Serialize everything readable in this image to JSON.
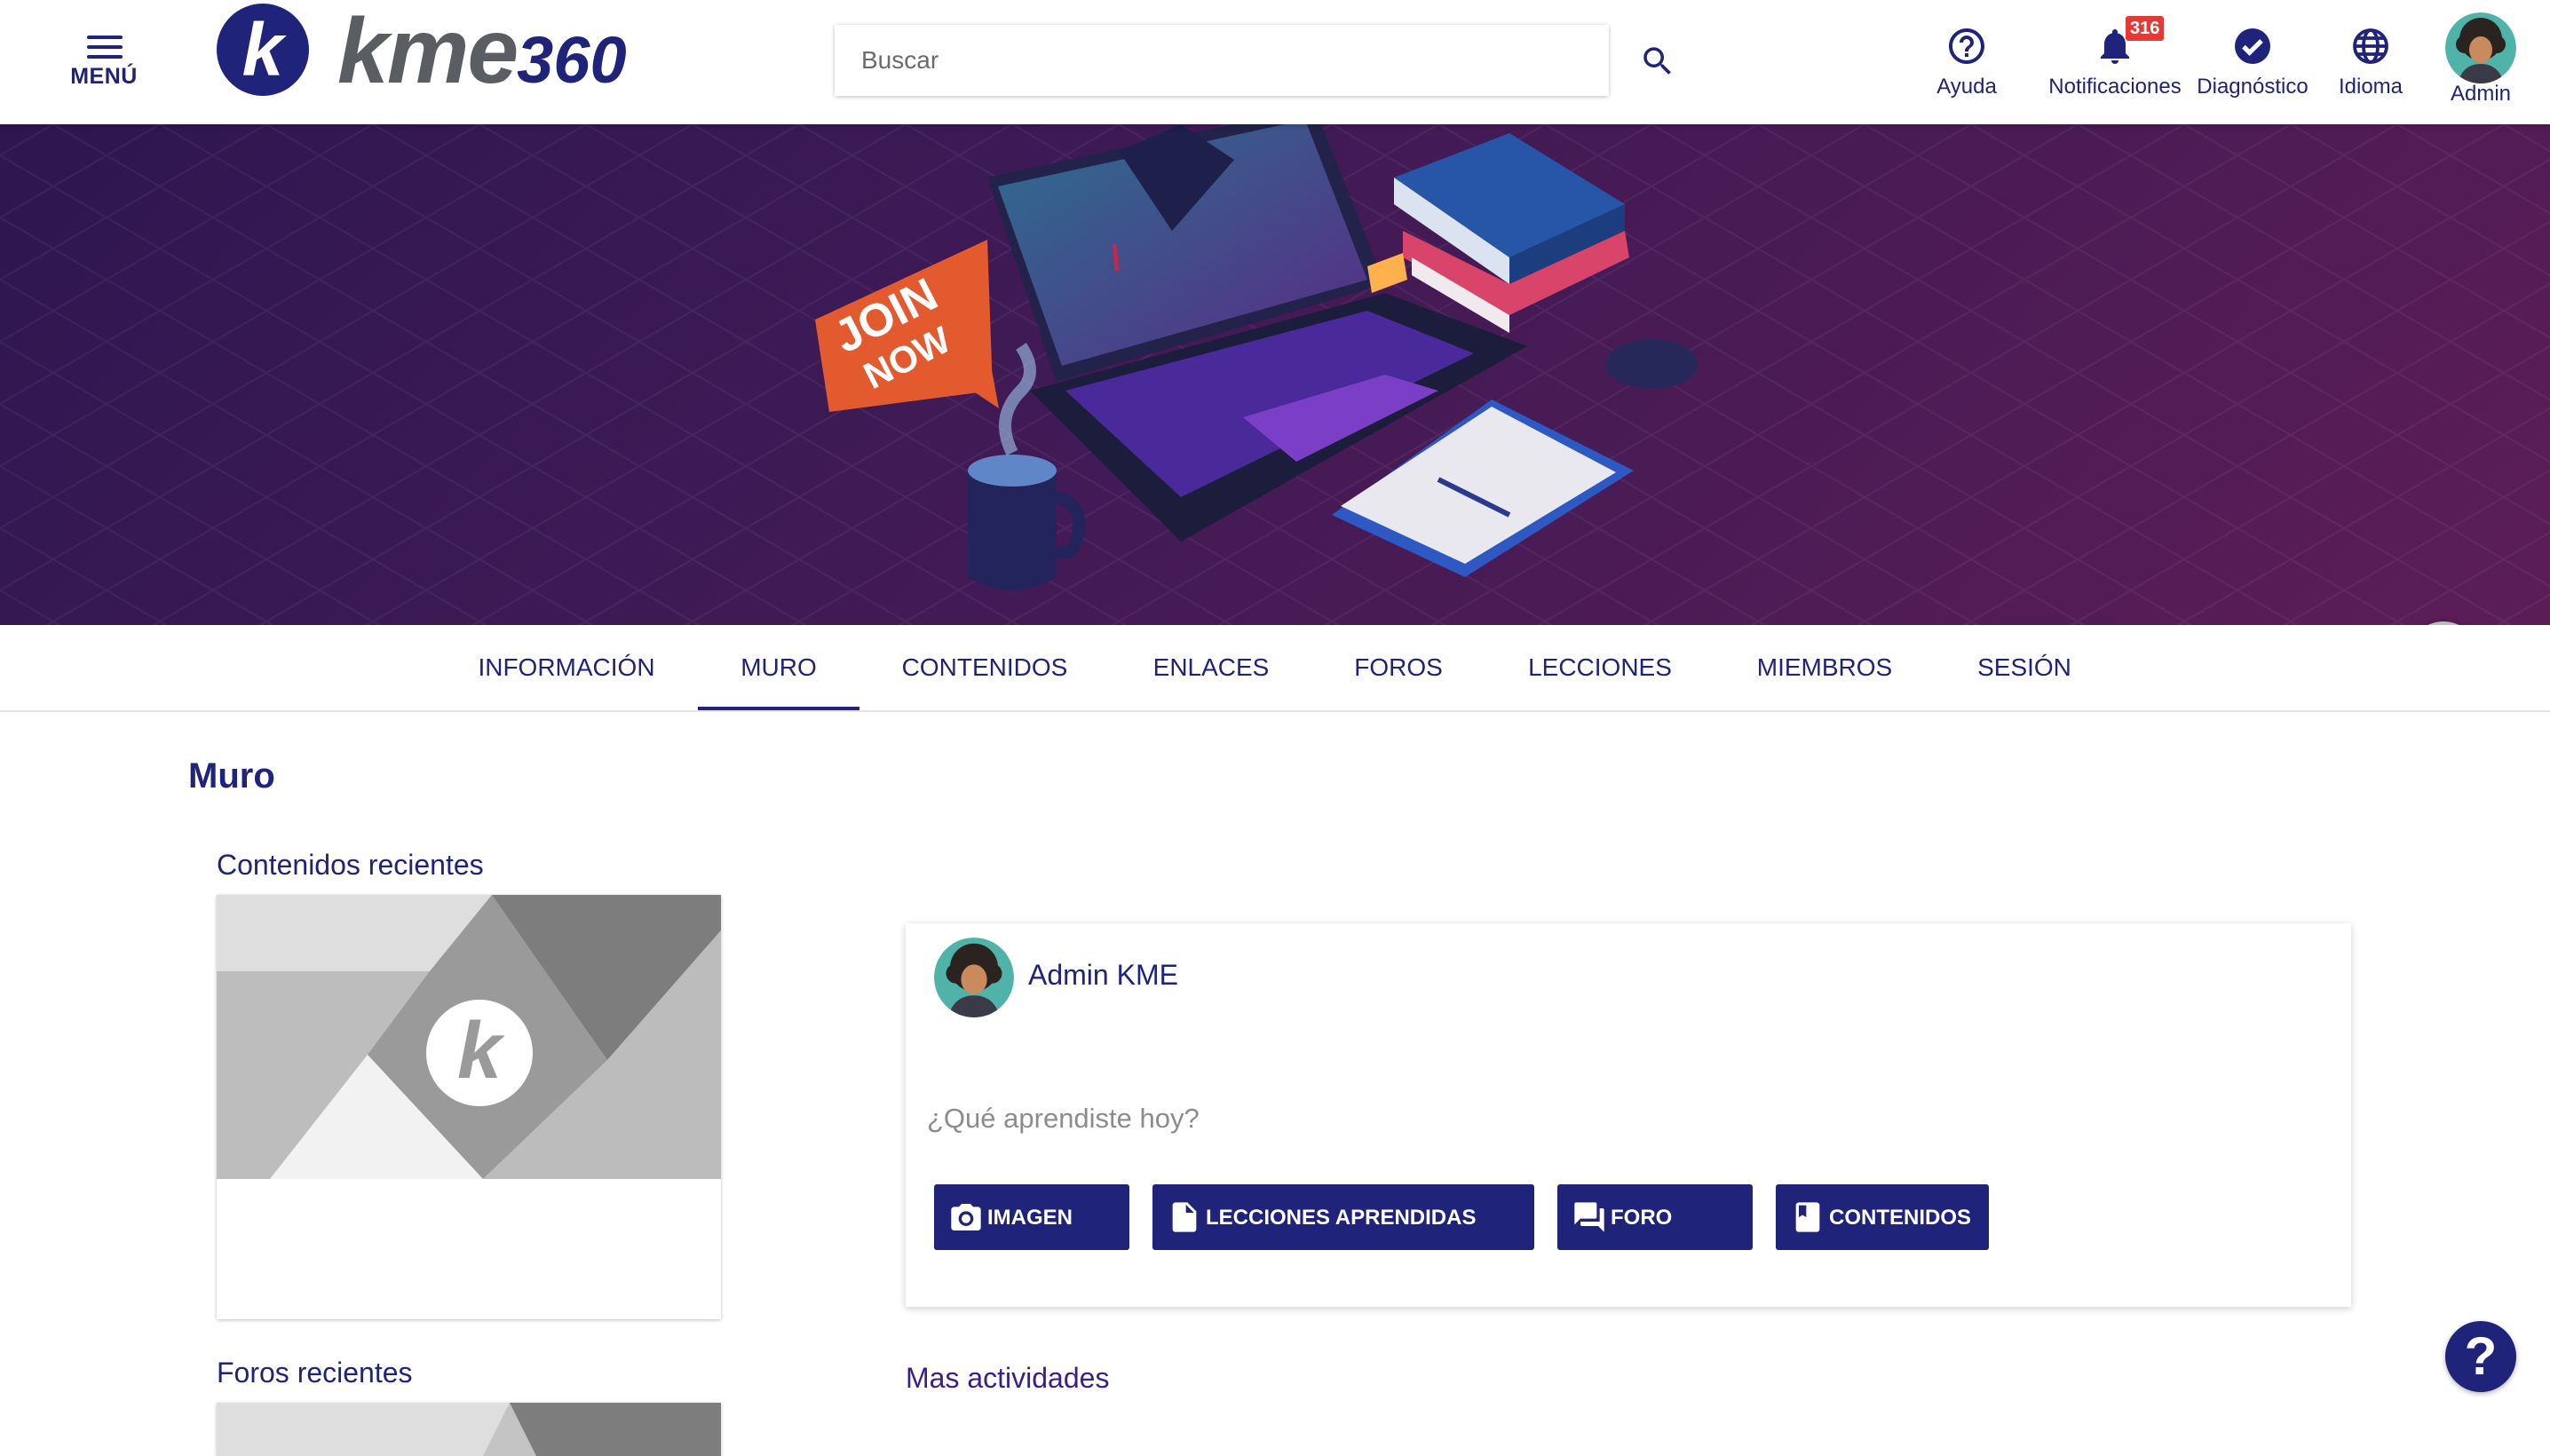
{
  "header": {
    "menu_label": "MENÚ",
    "logo_mark": "k",
    "logo_text_main": "kme",
    "logo_text_num": "360",
    "search": {
      "placeholder": "Buscar",
      "value": ""
    },
    "nav": [
      {
        "label": "Ayuda",
        "icon": "help-circle-icon"
      },
      {
        "label": "Notificaciones",
        "icon": "bell-icon",
        "badge": "316"
      },
      {
        "label": "Diagnóstico",
        "icon": "check-circle-icon"
      },
      {
        "label": "Idioma",
        "icon": "globe-icon"
      },
      {
        "label": "Admin",
        "icon": "avatar"
      }
    ]
  },
  "hero": {
    "sign_line1": "JOIN",
    "sign_line2": "NOW"
  },
  "tabs": [
    {
      "label": "INFORMACIÓN",
      "active": false
    },
    {
      "label": "MURO",
      "active": true
    },
    {
      "label": "CONTENIDOS",
      "active": false
    },
    {
      "label": "ENLACES",
      "active": false
    },
    {
      "label": "FOROS",
      "active": false
    },
    {
      "label": "LECCIONES",
      "active": false
    },
    {
      "label": "MIEMBROS",
      "active": false
    },
    {
      "label": "SESIÓN",
      "active": false
    }
  ],
  "main": {
    "title": "Muro",
    "recent_contents_title": "Contenidos recientes",
    "recent_forums_title": "Foros recientes",
    "thumb_mark": "k"
  },
  "post": {
    "author": "Admin KME",
    "placeholder": "¿Qué aprendiste hoy?",
    "value": "",
    "buttons": [
      {
        "label": "IMAGEN",
        "icon": "camera-icon"
      },
      {
        "label": "LECCIONES APRENDIDAS",
        "icon": "document-icon"
      },
      {
        "label": "FORO",
        "icon": "forum-icon"
      },
      {
        "label": "CONTENIDOS",
        "icon": "book-icon"
      }
    ]
  },
  "more_activities": "Mas actividades",
  "help_fab": "?",
  "colors": {
    "primary": "#1f237a",
    "badge": "#e53935",
    "hero_dark": "#2e1650",
    "hero_light": "#5c1d57",
    "accent_link": "#3a1f8a"
  }
}
